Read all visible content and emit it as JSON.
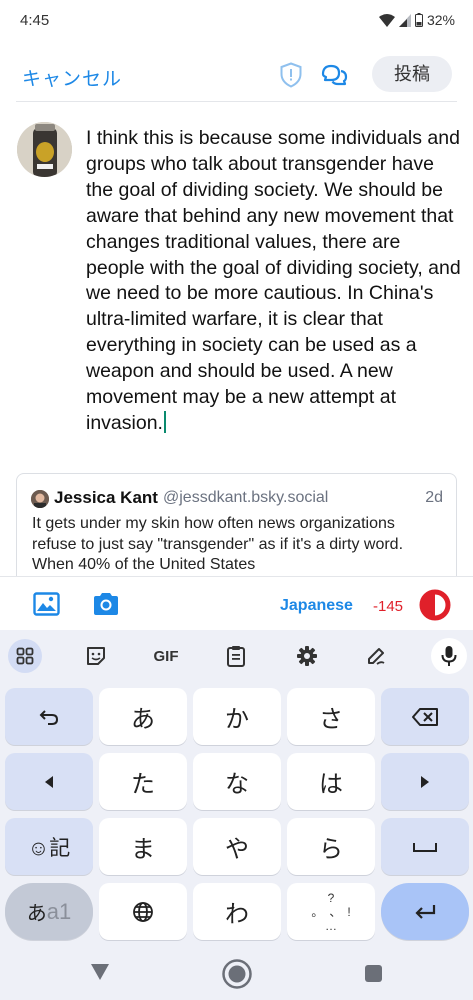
{
  "status": {
    "time": "4:45",
    "battery": "32%"
  },
  "header": {
    "cancel_label": "キャンセル",
    "post_label": "投稿"
  },
  "composer": {
    "text": "I think this is because some individuals and groups who talk about transgender have the goal of dividing society. We should be aware that behind any new movement that changes traditional values, there are people with the goal of dividing society, and we need to be more cautious. In China's ultra-limited warfare, it is clear that everything in society can be used as a weapon and should be used. A new movement may be a new attempt at invasion.",
    "avatar_label": "BLACK"
  },
  "quote": {
    "name": "Jessica Kant",
    "handle": "@jessdkant.bsky.social",
    "time": "2d",
    "text": "It gets under my skin how often news organizations refuse to just say \"transgender\" as if it's a dirty word. When 40% of the United States"
  },
  "toolbar": {
    "language": "Japanese",
    "char_count": "-145",
    "ring_color": "#e0202a"
  },
  "keyboard": {
    "gif_label": "GIF",
    "row1": [
      "あ",
      "か",
      "さ"
    ],
    "row2": [
      "た",
      "な",
      "は"
    ],
    "row3": [
      "ま",
      "や",
      "ら"
    ],
    "row4_middle": "わ",
    "emoji_key": "☺記",
    "mode_key_a": "あ",
    "mode_key_b": "a1",
    "punct_top": "?",
    "punct_left": "。",
    "punct_mid": "、",
    "punct_right": "!",
    "punct_bottom": "…"
  },
  "colors": {
    "accent": "#1d88e6",
    "warning": "#e0202a",
    "keyboard_bg": "#eef0f7"
  }
}
